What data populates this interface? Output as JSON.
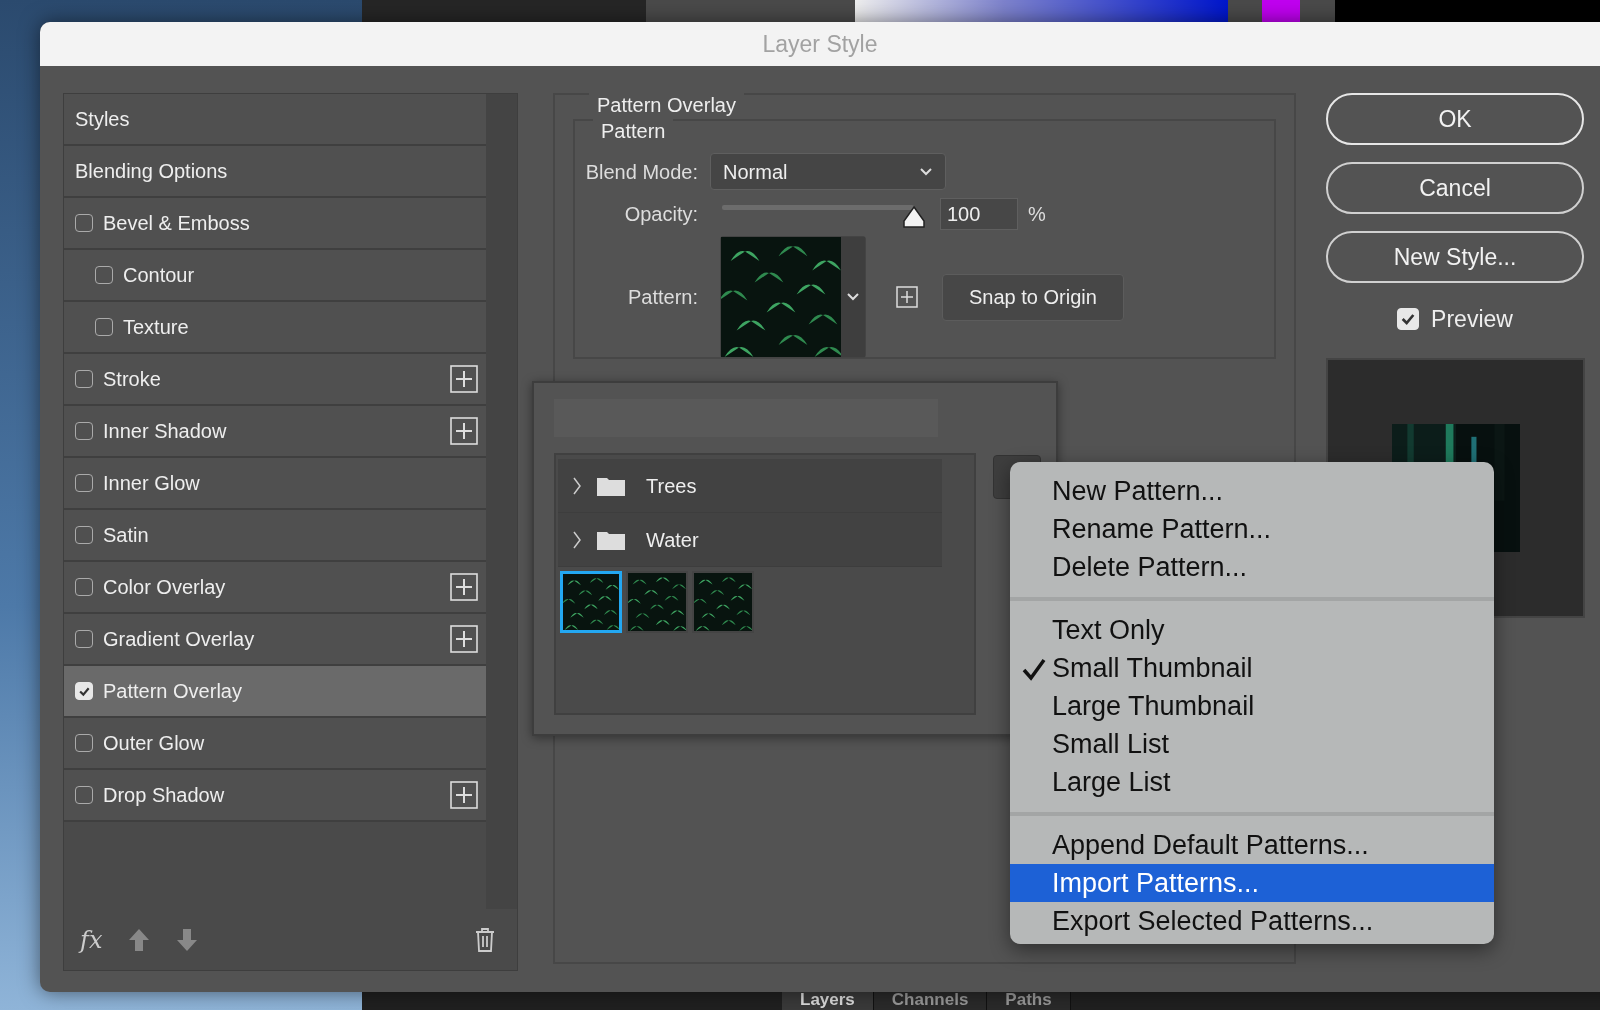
{
  "window": {
    "title": "Layer Style"
  },
  "background_tabs": [
    {
      "label": "Layers",
      "selected": true
    },
    {
      "label": "Channels",
      "selected": false
    },
    {
      "label": "Paths",
      "selected": false
    }
  ],
  "sidebar": {
    "items": [
      {
        "kind": "header",
        "label": "Styles",
        "selected": false
      },
      {
        "kind": "header",
        "label": "Blending Options",
        "selected": false
      },
      {
        "kind": "check",
        "label": "Bevel & Emboss",
        "checked": false,
        "indented": false,
        "addable": false,
        "selected": false
      },
      {
        "kind": "check",
        "label": "Contour",
        "checked": false,
        "indented": true,
        "addable": false,
        "selected": false
      },
      {
        "kind": "check",
        "label": "Texture",
        "checked": false,
        "indented": true,
        "addable": false,
        "selected": false
      },
      {
        "kind": "check",
        "label": "Stroke",
        "checked": false,
        "indented": false,
        "addable": true,
        "selected": false
      },
      {
        "kind": "check",
        "label": "Inner Shadow",
        "checked": false,
        "indented": false,
        "addable": true,
        "selected": false
      },
      {
        "kind": "check",
        "label": "Inner Glow",
        "checked": false,
        "indented": false,
        "addable": false,
        "selected": false
      },
      {
        "kind": "check",
        "label": "Satin",
        "checked": false,
        "indented": false,
        "addable": false,
        "selected": false
      },
      {
        "kind": "check",
        "label": "Color Overlay",
        "checked": false,
        "indented": false,
        "addable": true,
        "selected": false
      },
      {
        "kind": "check",
        "label": "Gradient Overlay",
        "checked": false,
        "indented": false,
        "addable": true,
        "selected": false
      },
      {
        "kind": "check",
        "label": "Pattern Overlay",
        "checked": true,
        "indented": false,
        "addable": false,
        "selected": true
      },
      {
        "kind": "check",
        "label": "Outer Glow",
        "checked": false,
        "indented": false,
        "addable": false,
        "selected": false
      },
      {
        "kind": "check",
        "label": "Drop Shadow",
        "checked": false,
        "indented": false,
        "addable": true,
        "selected": false
      }
    ],
    "footer_label": "fx"
  },
  "pattern_overlay": {
    "title": "Pattern Overlay",
    "group": "Pattern",
    "blend_mode": {
      "label": "Blend Mode:",
      "value": "Normal"
    },
    "opacity": {
      "label": "Opacity:",
      "level": 1.0,
      "value": "100",
      "unit": "%"
    },
    "pattern": {
      "label": "Pattern:"
    },
    "snap_button": "Snap to Origin"
  },
  "pattern_picker": {
    "folders": [
      {
        "name": "Trees",
        "expanded": false
      },
      {
        "name": "Water",
        "expanded": false
      }
    ],
    "swatches": [
      {
        "selected": true
      },
      {
        "selected": false
      },
      {
        "selected": false
      }
    ]
  },
  "menu": {
    "groups": [
      {
        "items": [
          {
            "label": "New Pattern...",
            "checked": false,
            "selected": false
          },
          {
            "label": "Rename Pattern...",
            "checked": false,
            "selected": false
          },
          {
            "label": "Delete Pattern...",
            "checked": false,
            "selected": false
          }
        ]
      },
      {
        "items": [
          {
            "label": "Text Only",
            "checked": false,
            "selected": false
          },
          {
            "label": "Small Thumbnail",
            "checked": true,
            "selected": false
          },
          {
            "label": "Large Thumbnail",
            "checked": false,
            "selected": false
          },
          {
            "label": "Small List",
            "checked": false,
            "selected": false
          },
          {
            "label": "Large List",
            "checked": false,
            "selected": false
          }
        ]
      },
      {
        "items": [
          {
            "label": "Append Default Patterns...",
            "checked": false,
            "selected": false
          },
          {
            "label": "Import Patterns...",
            "checked": false,
            "selected": true
          },
          {
            "label": "Export Selected Patterns...",
            "checked": false,
            "selected": false
          }
        ]
      }
    ]
  },
  "buttons": [
    {
      "label": "OK"
    },
    {
      "label": "Cancel"
    },
    {
      "label": "New Style..."
    }
  ],
  "preview": {
    "label": "Preview",
    "checked": true
  }
}
